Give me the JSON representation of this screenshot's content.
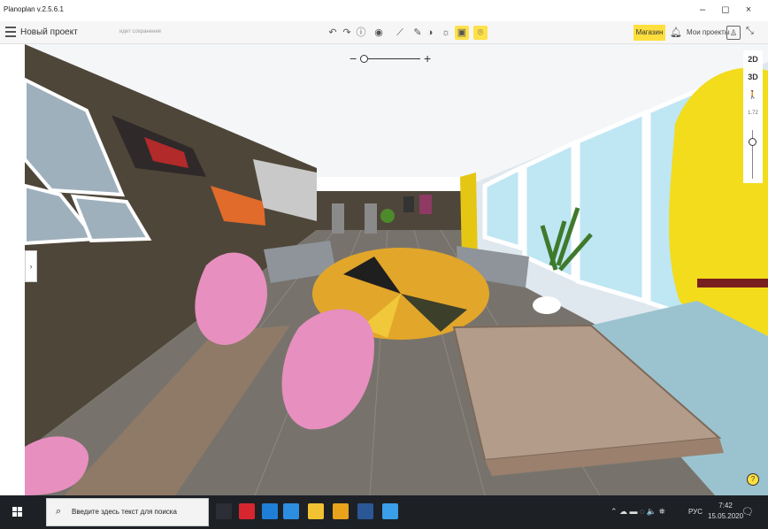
{
  "app": {
    "title": "Planoplan v.2.5.6.1",
    "window_controls": {
      "minimize": "–",
      "maximize": "◻",
      "close": "×"
    }
  },
  "toolbar": {
    "project_name": "Новый проект",
    "save_status": "идет сохранение",
    "tools": [
      {
        "name": "undo-icon",
        "glyph": "↶"
      },
      {
        "name": "redo-icon",
        "glyph": "↷"
      },
      {
        "name": "info-icon",
        "glyph": "ⓘ"
      },
      {
        "name": "eye-icon",
        "glyph": "◉"
      },
      {
        "name": "ruler-icon",
        "glyph": "⟋"
      },
      {
        "name": "paint-icon",
        "glyph": "✎"
      },
      {
        "name": "visibility-icon",
        "glyph": "◑"
      },
      {
        "name": "light-icon",
        "glyph": "☼"
      },
      {
        "name": "render-icon",
        "glyph": "▣"
      },
      {
        "name": "camera-icon",
        "glyph": "⌾"
      }
    ],
    "shop_label": "Магазин",
    "projects_label": "Мои проекты"
  },
  "view_panel": {
    "mode_2d": "2D",
    "mode_3d": "3D",
    "walk_glyph": "🚶",
    "eye_height": "1.72"
  },
  "zoom": {
    "minus": "−",
    "plus": "+"
  },
  "help_label": "?",
  "expand_label": "›",
  "taskbar": {
    "search_placeholder": "Введите здесь текст для поиска",
    "apps": [
      {
        "name": "task-view-icon",
        "color": "#2b2f35"
      },
      {
        "name": "app-red-icon",
        "color": "#d8262f"
      },
      {
        "name": "store-icon",
        "color": "#1f7fd6"
      },
      {
        "name": "edge-icon",
        "color": "#2d8ee0"
      },
      {
        "name": "folder-icon",
        "color": "#f2c232"
      },
      {
        "name": "chrome-icon",
        "color": "#e8a21c"
      },
      {
        "name": "word-icon",
        "color": "#2b5797"
      },
      {
        "name": "planoplan-icon",
        "color": "#3a9ee8"
      }
    ],
    "tray_glyphs": "⌃  ☁  ▬  ◌  🔈  ⛯",
    "language": "РУС",
    "time": "7:42",
    "date": "15.05.2020",
    "notification_glyph": "🗨"
  }
}
